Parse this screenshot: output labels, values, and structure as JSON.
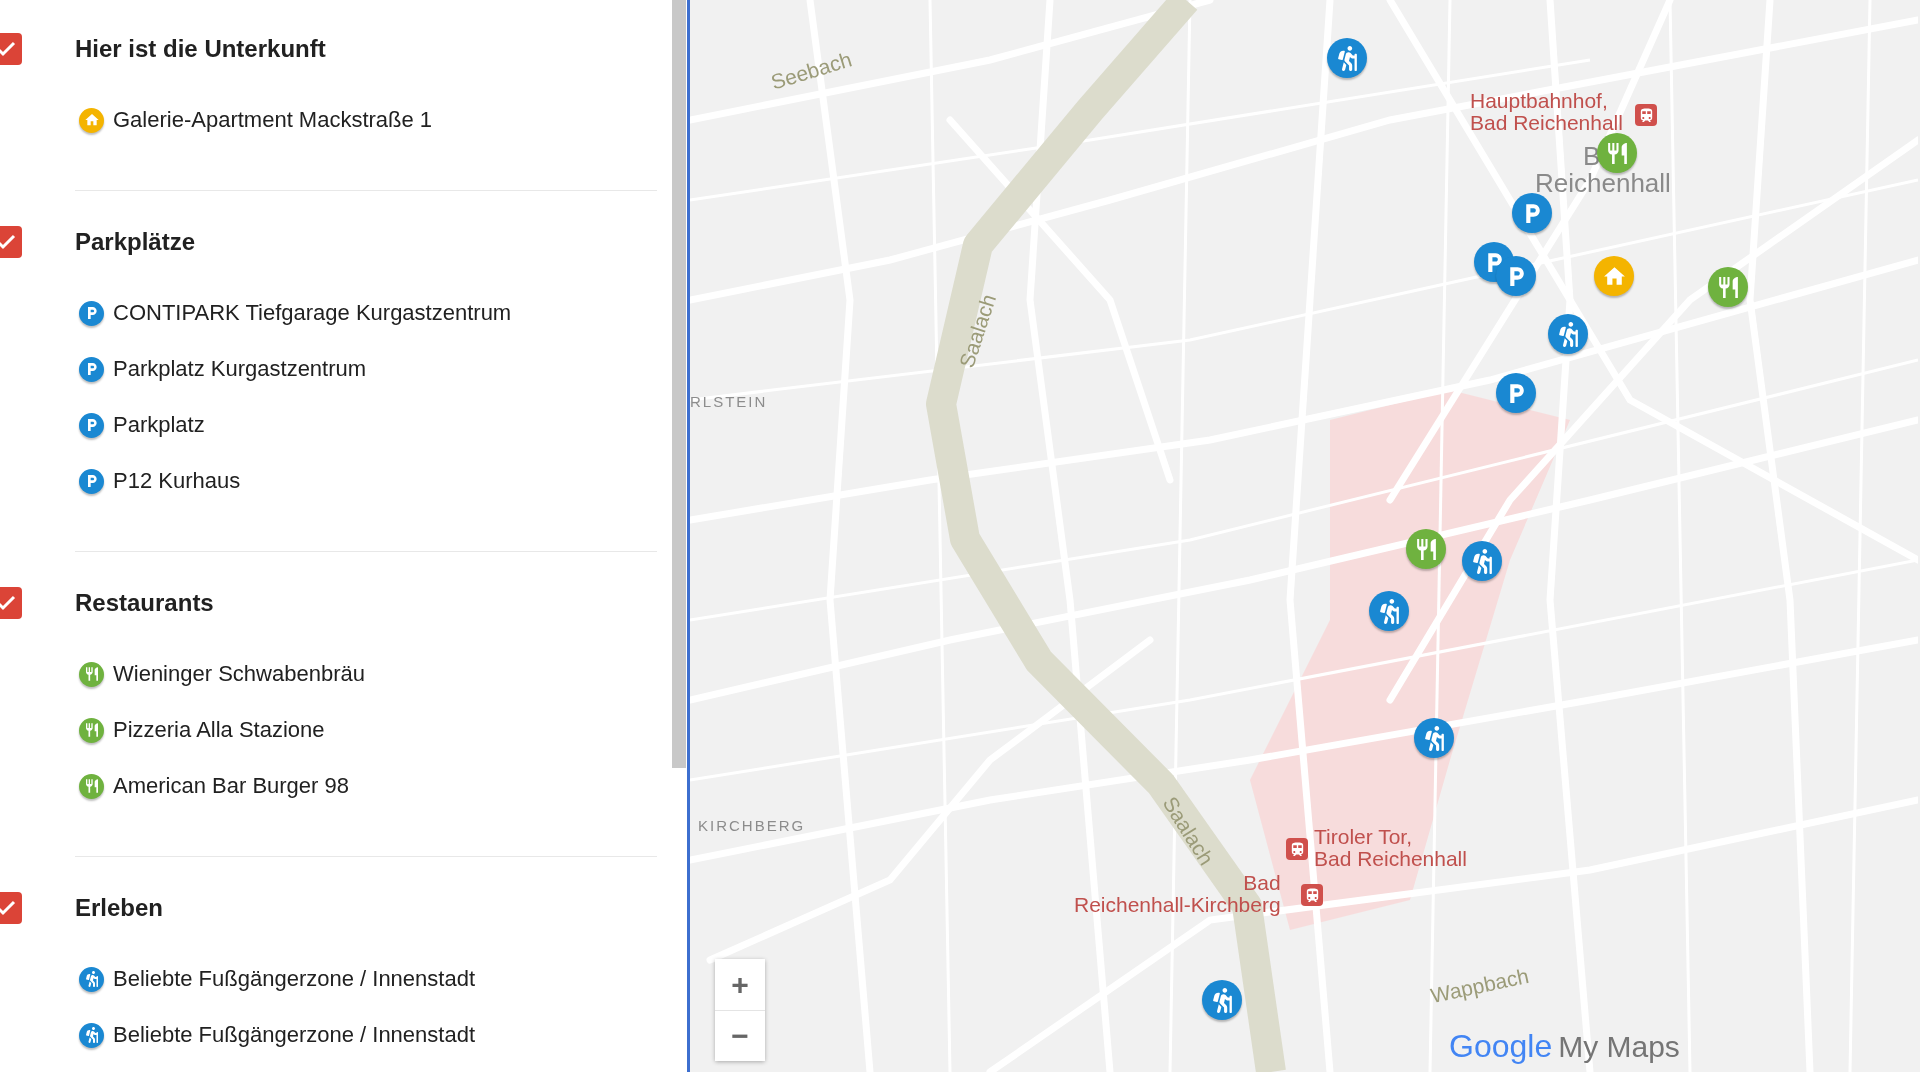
{
  "sections": [
    {
      "title": "Hier ist die Unterkunft",
      "checked": true,
      "items": [
        {
          "name": "Galerie-Apartment Mackstraße 1",
          "kind": "house"
        }
      ]
    },
    {
      "title": "Parkplätze",
      "checked": true,
      "items": [
        {
          "name": "CONTIPARK Tiefgarage Kurgastzentrum",
          "kind": "parking"
        },
        {
          "name": "Parkplatz Kurgastzentrum",
          "kind": "parking"
        },
        {
          "name": "Parkplatz",
          "kind": "parking"
        },
        {
          "name": "P12 Kurhaus",
          "kind": "parking"
        }
      ]
    },
    {
      "title": "Restaurants",
      "checked": true,
      "items": [
        {
          "name": "Wieninger Schwabenbräu",
          "kind": "restaurant"
        },
        {
          "name": "Pizzeria Alla Stazione",
          "kind": "restaurant"
        },
        {
          "name": "American Bar Burger 98",
          "kind": "restaurant"
        }
      ]
    },
    {
      "title": "Erleben",
      "checked": true,
      "items": [
        {
          "name": "Beliebte Fußgängerzone / Innenstadt",
          "kind": "hiking"
        },
        {
          "name": "Beliebte Fußgängerzone / Innenstadt",
          "kind": "hiking"
        }
      ]
    }
  ],
  "map": {
    "labels": [
      {
        "text": "Seebach",
        "kind": "water"
      },
      {
        "text": "Hauptbahnhof,\nBad Reichenhall",
        "kind": "station"
      },
      {
        "text": "B",
        "kind": "town"
      },
      {
        "text": "Reichenhall",
        "kind": "town"
      },
      {
        "text": "Saalach",
        "kind": "water"
      },
      {
        "text": "RLSTEIN",
        "kind": "district"
      },
      {
        "text": "KIRCHBERG",
        "kind": "district"
      },
      {
        "text": "Saalach",
        "kind": "water"
      },
      {
        "text": "Tiroler Tor,\nBad Reichenhall",
        "kind": "station"
      },
      {
        "text": "Bad\nReichenhall-Kirchberg",
        "kind": "station"
      },
      {
        "text": "Wappbach",
        "kind": "water"
      }
    ],
    "markers": [
      {
        "kind": "hiking"
      },
      {
        "kind": "parking"
      },
      {
        "kind": "restaurant"
      },
      {
        "kind": "parking"
      },
      {
        "kind": "parking"
      },
      {
        "kind": "house"
      },
      {
        "kind": "restaurant"
      },
      {
        "kind": "hiking"
      },
      {
        "kind": "parking"
      },
      {
        "kind": "restaurant"
      },
      {
        "kind": "hiking"
      },
      {
        "kind": "hiking"
      },
      {
        "kind": "hiking"
      },
      {
        "kind": "hiking"
      }
    ],
    "zoom_in": "+",
    "zoom_out": "−",
    "logo": {
      "brand": "Google",
      "product": "My Maps"
    }
  }
}
